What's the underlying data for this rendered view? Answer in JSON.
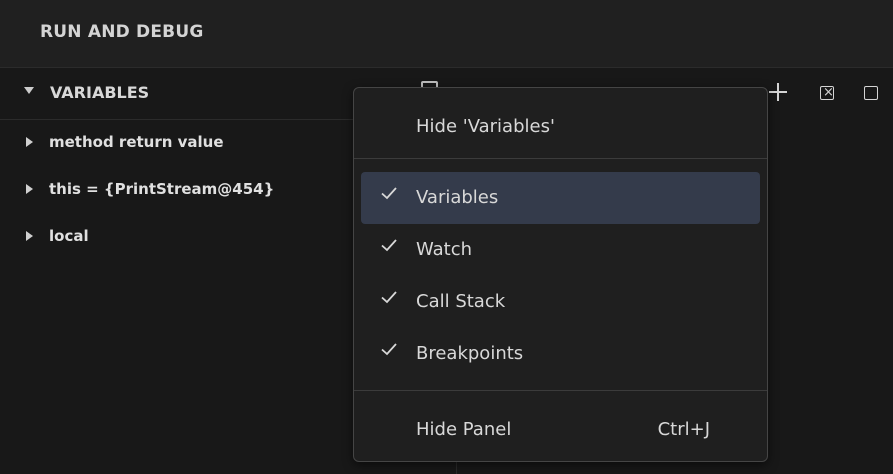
{
  "header": {
    "title": "RUN AND DEBUG"
  },
  "variables_section": {
    "title": "VARIABLES",
    "items": [
      {
        "label": "method return value"
      },
      {
        "label": "this = {PrintStream@454}"
      },
      {
        "label": "local"
      }
    ]
  },
  "toolbar": {
    "add_icon": "plus-icon",
    "collapse_icon": "collapse-all-icon",
    "partial_icon": "panel-icon"
  },
  "context_menu": {
    "hide_section_label": "Hide 'Variables'",
    "items": [
      {
        "label": "Variables",
        "checked": true,
        "highlighted": true
      },
      {
        "label": "Watch",
        "checked": true,
        "highlighted": false
      },
      {
        "label": "Call Stack",
        "checked": true,
        "highlighted": false
      },
      {
        "label": "Breakpoints",
        "checked": true,
        "highlighted": false
      }
    ],
    "hide_panel_label": "Hide Panel",
    "hide_panel_shortcut": "Ctrl+J"
  },
  "colors": {
    "background": "#181818",
    "header_background": "#202020",
    "menu_background": "#1f1f1f",
    "menu_highlight": "#343b4b",
    "text": "#d8d8d8"
  }
}
